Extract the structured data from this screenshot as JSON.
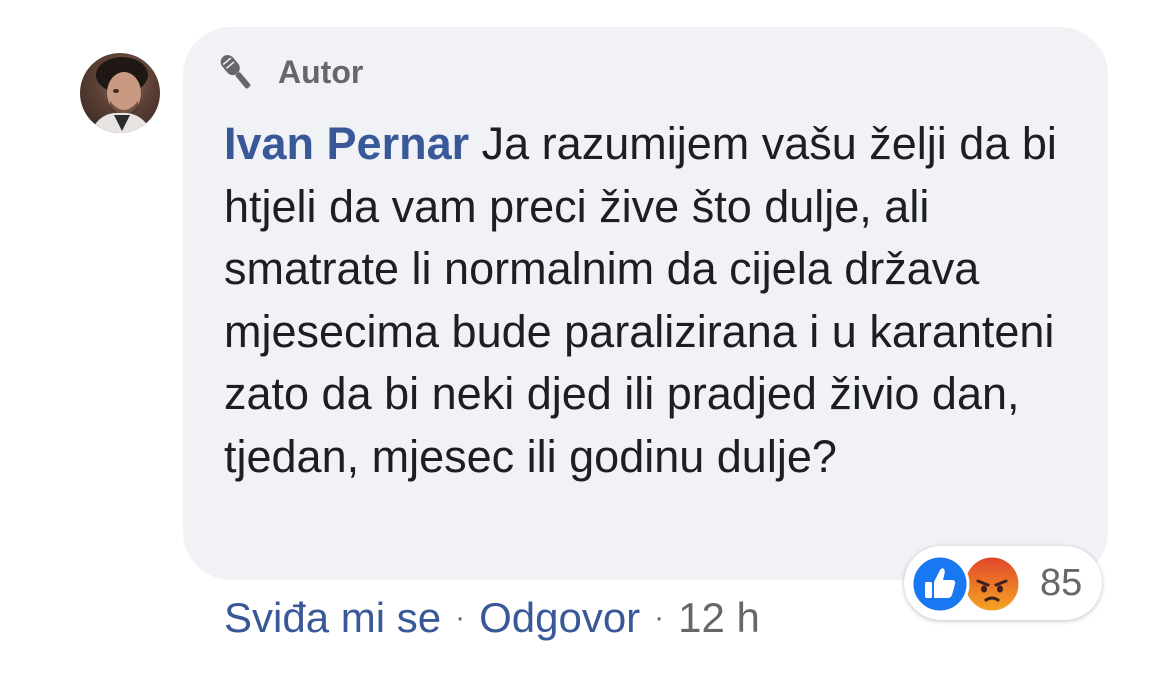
{
  "comment": {
    "badge_label": "Autor",
    "author_name": "Ivan Pernar",
    "text": "Ja razumijem vašu želji da bi htjeli da vam preci žive što dulje, ali smatrate li normalnim da cijela država mjesecima bude paralizirana i u karanteni zato da bi neki djed ili pradjed živio dan, tjedan, mjesec ili godinu dulje?"
  },
  "actions": {
    "like_label": "Sviđa mi se",
    "separator": "·",
    "reply_label": "Odgovor",
    "time": "12 h"
  },
  "reactions": {
    "icons": [
      "like-reaction-icon",
      "angry-reaction-icon"
    ],
    "count": "85"
  },
  "colors": {
    "bubble_bg": "#f0f2f5",
    "link_blue": "#385898",
    "secondary_gray": "#65676b",
    "like_blue": "#1877f2",
    "angry_orange": "#f06a2a"
  }
}
